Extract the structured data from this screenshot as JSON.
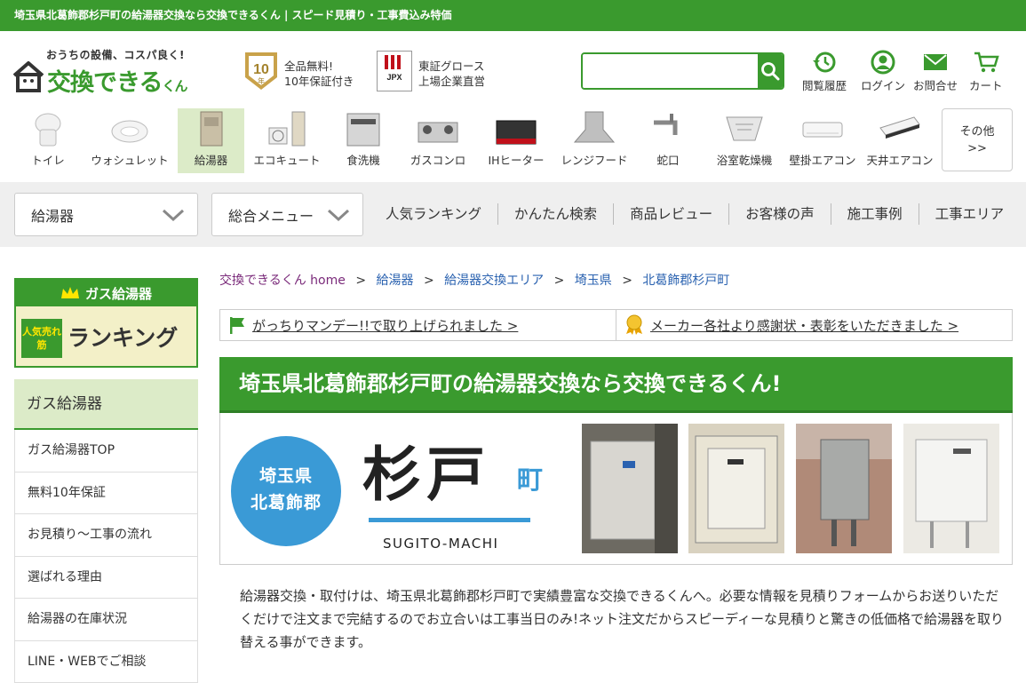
{
  "topbar": {
    "title": "埼玉県北葛飾郡杉戸町の給湯器交換なら交換できるくん | スピード見積り・工事費込み特価"
  },
  "header": {
    "logo_tagline": "おうちの設備、コスパ良く!",
    "logo_main": "交換できる",
    "logo_small": "くん",
    "badge_number": "10",
    "badge_year": "年",
    "badge_line1": "全品無料!",
    "badge_line2": "10年保証付き",
    "jpx_label": "JPX",
    "jpx_line1": "東証グロース",
    "jpx_line2": "上場企業直営",
    "search_placeholder": "",
    "nav": [
      {
        "label": "閲覧履歴",
        "icon": "history-icon"
      },
      {
        "label": "ログイン",
        "icon": "user-icon"
      },
      {
        "label": "お問合せ",
        "icon": "mail-icon"
      },
      {
        "label": "カート",
        "icon": "cart-icon"
      }
    ]
  },
  "categories": [
    {
      "label": "トイレ"
    },
    {
      "label": "ウォシュレット"
    },
    {
      "label": "給湯器"
    },
    {
      "label": "エコキュート"
    },
    {
      "label": "食洗機"
    },
    {
      "label": "ガスコンロ"
    },
    {
      "label": "IHヒーター"
    },
    {
      "label": "レンジフード"
    },
    {
      "label": "蛇口"
    },
    {
      "label": "浴室乾燥機"
    },
    {
      "label": "壁掛エアコン"
    },
    {
      "label": "天井エアコン"
    }
  ],
  "categories_more": {
    "line1": "その他",
    "line2": ">>"
  },
  "menubar": {
    "dropdown1": "給湯器",
    "dropdown2": "総合メニュー",
    "links": [
      "人気ランキング",
      "かんたん検索",
      "商品レビュー",
      "お客様の声",
      "施工事例",
      "工事エリア"
    ]
  },
  "sidebar": {
    "rank_top": "ガス給湯器",
    "rank_tag": "人気売れ筋",
    "rank_main": "ランキング",
    "head": "ガス給湯器",
    "items": [
      "ガス給湯器TOP",
      "無料10年保証",
      "お見積り～工事の流れ",
      "選ばれる理由",
      "給湯器の在庫状況",
      "LINE・WEBでご相談"
    ]
  },
  "breadcrumb": {
    "home": "交換できるくん home",
    "sep": ">",
    "items": [
      "給湯器",
      "給湯器交換エリア",
      "埼玉県",
      "北葛飾郡杉戸町"
    ]
  },
  "notices": [
    "がっちりマンデー!!で取り上げられました >",
    "メーカー各社より感謝状・表彰をいただきました >"
  ],
  "hero": {
    "title": "埼玉県北葛飾郡杉戸町の給湯器交換なら交換できるくん!",
    "circle_line1": "埼玉県",
    "circle_line2": "北葛飾郡",
    "town_kanji": "杉戸",
    "town_suffix": "町",
    "town_roman": "SUGITO-MACHI"
  },
  "intro": "給湯器交換・取付けは、埼玉県北葛飾郡杉戸町で実績豊富な交換できるくんへ。必要な情報を見積りフォームからお送りいただくだけで注文まで完結するのでお立合いは工事当日のみ!ネット注文だからスピーディーな見積りと驚きの低価格で給湯器を取り替える事ができます。",
  "colors": {
    "brand_green": "#3a9a2e",
    "light_green": "#dcebc8",
    "accent_blue": "#3a9ad6"
  }
}
